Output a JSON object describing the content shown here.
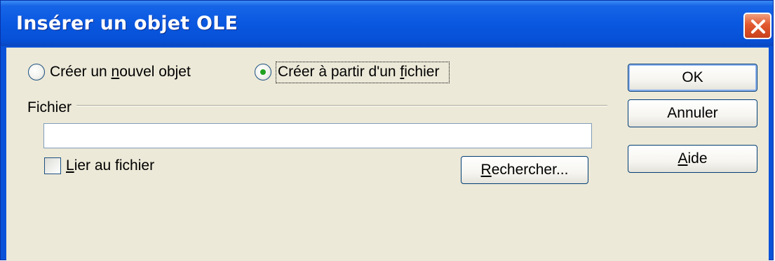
{
  "window": {
    "title": "Insérer un objet OLE"
  },
  "options": {
    "create_new": {
      "pre": "Créer un ",
      "mnemonic": "n",
      "post": "ouvel objet",
      "selected": false
    },
    "create_from_file": {
      "pre": "Créer à partir d'un ",
      "mnemonic": "f",
      "post": "ichier",
      "selected": true
    }
  },
  "file_group": {
    "label": "Fichier",
    "path_value": ""
  },
  "link": {
    "mnemonic": "L",
    "post": "ier au fichier",
    "checked": false
  },
  "buttons": {
    "browse": {
      "mnemonic": "R",
      "post": "echercher..."
    },
    "ok": "OK",
    "cancel": "Annuler",
    "help": {
      "mnemonic": "A",
      "post": "ide"
    }
  },
  "colors": {
    "title_bar": "#0a58e0",
    "client_bg": "#ece9d8",
    "close_button": "#e2582e",
    "radio_dot": "#21a121"
  }
}
